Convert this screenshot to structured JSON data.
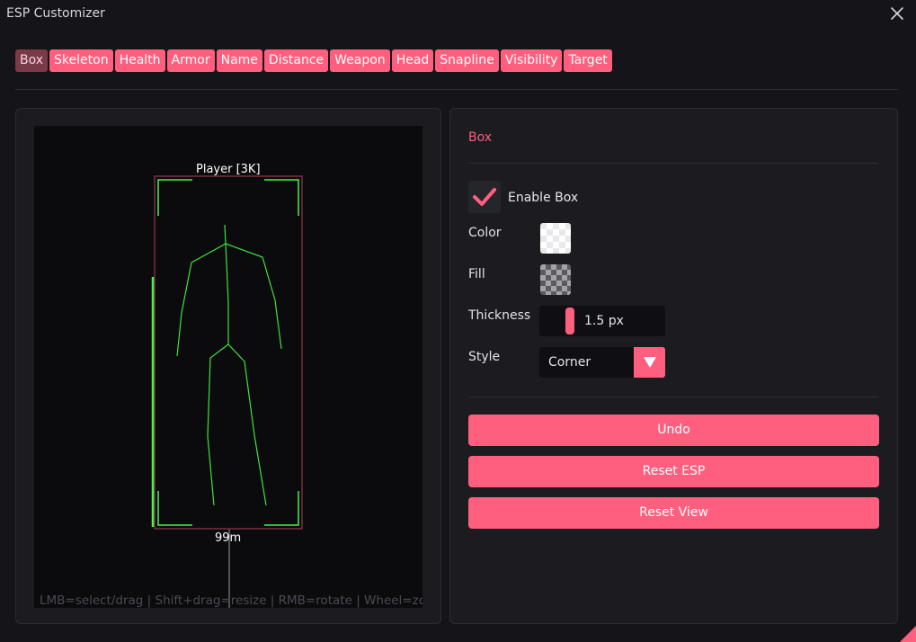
{
  "window": {
    "title": "ESP Customizer"
  },
  "tabs": [
    {
      "label": "Box",
      "active": true
    },
    {
      "label": "Skeleton"
    },
    {
      "label": "Health"
    },
    {
      "label": "Armor"
    },
    {
      "label": "Name"
    },
    {
      "label": "Distance"
    },
    {
      "label": "Weapon"
    },
    {
      "label": "Head"
    },
    {
      "label": "Snapline"
    },
    {
      "label": "Visibility"
    },
    {
      "label": "Target"
    }
  ],
  "preview": {
    "player_label": "Player [3K]",
    "distance_label": "99m",
    "hint": "LMB=select/drag | Shift+drag=resize | RMB=rotate | Wheel=zoom",
    "colors": {
      "box": "#7a2e3f",
      "corners": "#4ef04e",
      "skeleton": "#3ee23e",
      "snapline": "#9a9aa0"
    }
  },
  "settings": {
    "section_title": "Box",
    "enable_box": {
      "label": "Enable Box",
      "checked": true
    },
    "color_label": "Color",
    "fill_label": "Fill",
    "thickness": {
      "label": "Thickness",
      "value": "1.5 px"
    },
    "style": {
      "label": "Style",
      "value": "Corner"
    },
    "buttons": {
      "undo": "Undo",
      "reset_esp": "Reset ESP",
      "reset_view": "Reset View"
    }
  },
  "theme": {
    "accent": "#ff5f7e",
    "tab_active": "#7a3a4a"
  }
}
